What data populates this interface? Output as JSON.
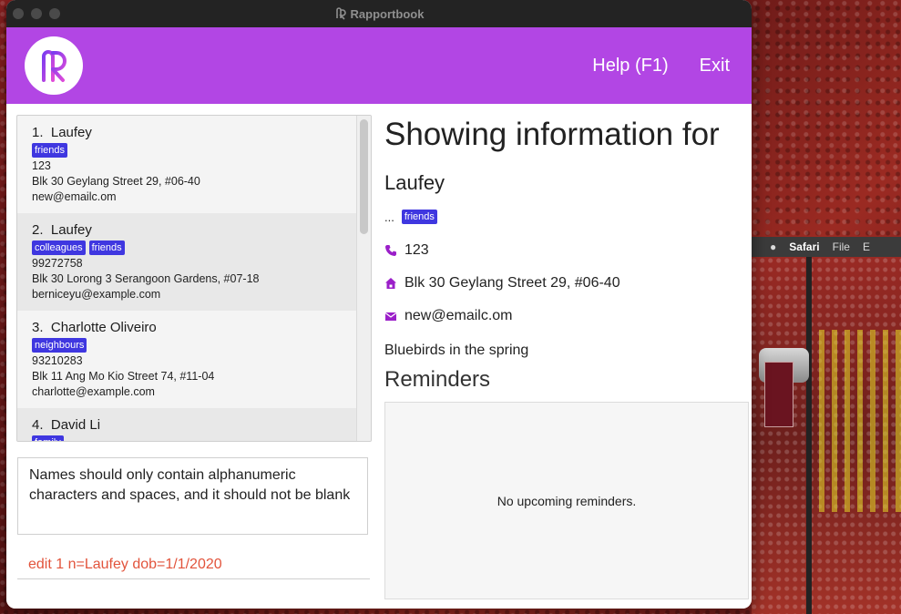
{
  "window": {
    "title": "Rapportbook"
  },
  "header": {
    "help_label": "Help (F1)",
    "exit_label": "Exit"
  },
  "contacts": [
    {
      "index": "1.",
      "name": "Laufey",
      "tags": [
        "friends"
      ],
      "phone": "123",
      "address": "Blk 30 Geylang Street 29, #06-40",
      "email": "new@emailc.om"
    },
    {
      "index": "2.",
      "name": "Laufey",
      "tags": [
        "colleagues",
        "friends"
      ],
      "phone": "99272758",
      "address": "Blk 30 Lorong 3 Serangoon Gardens, #07-18",
      "email": "berniceyu@example.com"
    },
    {
      "index": "3.",
      "name": "Charlotte Oliveiro",
      "tags": [
        "neighbours"
      ],
      "phone": "93210283",
      "address": "Blk 11 Ang Mo Kio Street 74, #11-04",
      "email": "charlotte@example.com"
    },
    {
      "index": "4.",
      "name": "David Li",
      "tags": [
        "family"
      ],
      "phone": "",
      "address": "",
      "email": ""
    }
  ],
  "result_message": "Names should only contain alphanumeric characters and spaces, and it should not be blank",
  "command": {
    "value": "edit 1 n=Laufey dob=1/1/2020"
  },
  "detail": {
    "heading": "Showing information for",
    "name": "Laufey",
    "ellipsis": "...",
    "tag": "friends",
    "phone": "123",
    "address": "Blk 30 Geylang Street 29, #06-40",
    "email": "new@emailc.om",
    "notes": "Bluebirds in the spring",
    "reminders_heading": "Reminders",
    "reminders_empty": "No upcoming reminders."
  },
  "background_menu": {
    "app": "Safari",
    "file": "File",
    "edit": "E"
  },
  "colors": {
    "accent": "#b246e4",
    "tag": "#3f37e0",
    "command_text": "#e2543c",
    "icon": "#9b1fc9"
  }
}
